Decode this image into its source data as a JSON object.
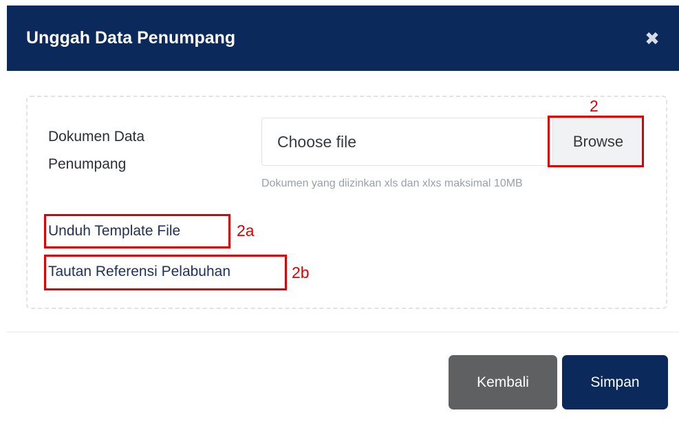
{
  "modal": {
    "title": "Unggah Data Penumpang",
    "close_icon": "close-icon",
    "colors": {
      "header": "#0b2a5b",
      "annotation": "#e00000",
      "secondary_button": "#5e6062"
    }
  },
  "form": {
    "document_label": "Dokumen Data Penumpang",
    "file_placeholder": "Choose file",
    "browse_label": "Browse",
    "hint": "Dokumen yang diizinkan xls dan xlxs maksimal 10MB",
    "link_template": "Unduh Template File",
    "link_pelabuhan": "Tautan Referensi Pelabuhan"
  },
  "annotations": {
    "browse": "2",
    "template": "2a",
    "pelabuhan": "2b"
  },
  "footer": {
    "back_label": "Kembali",
    "save_label": "Simpan"
  }
}
